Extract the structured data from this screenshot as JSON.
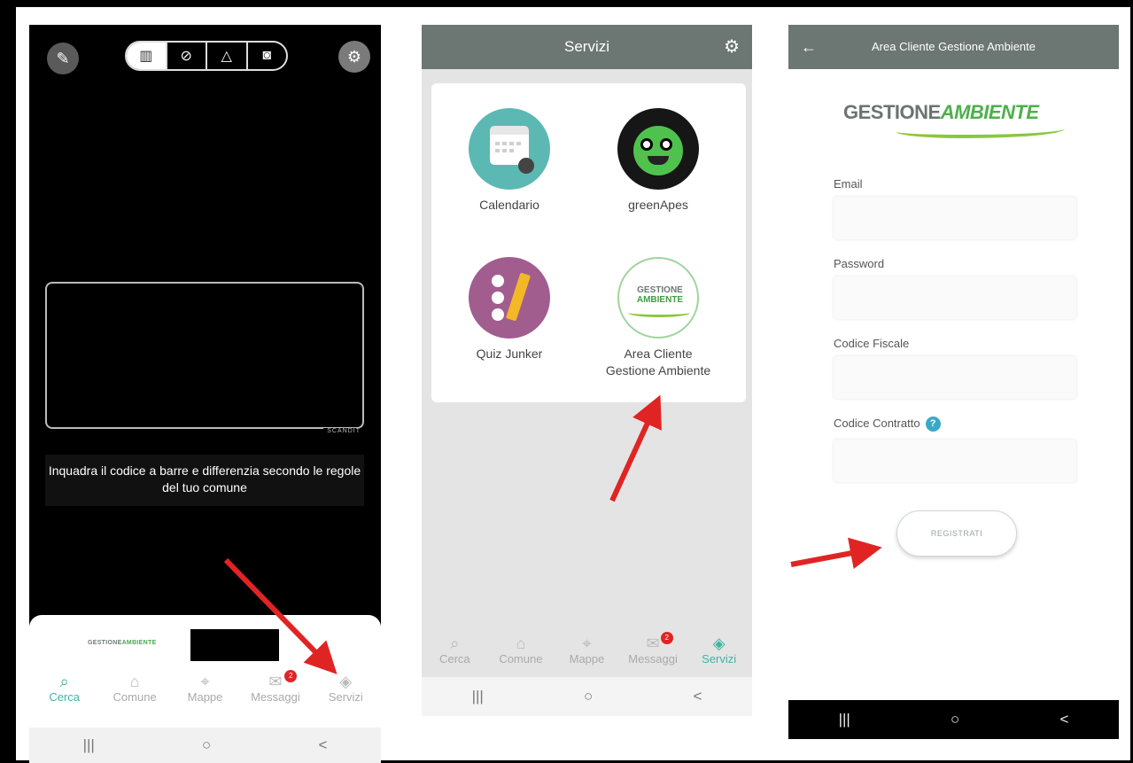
{
  "screen1": {
    "mode_icons": [
      "barcode-icon",
      "search-icon",
      "warning-icon",
      "camera-icon"
    ],
    "scan_brand": "SCANDIT",
    "hint_text": "Inquadra il codice a barre e differenzia secondo le regole del tuo comune",
    "mini_logo": {
      "part1": "GESTIONE",
      "part2": "AMBIENTE"
    },
    "tabs": [
      {
        "label": "Cerca",
        "icon": "search-icon",
        "active": true
      },
      {
        "label": "Comune",
        "icon": "building-icon",
        "active": false
      },
      {
        "label": "Mappe",
        "icon": "map-icon",
        "active": false
      },
      {
        "label": "Messaggi",
        "icon": "mail-icon",
        "active": false,
        "badge": "2"
      },
      {
        "label": "Servizi",
        "icon": "layers-icon",
        "active": false
      }
    ],
    "nav": [
      "|||",
      "○",
      "<"
    ]
  },
  "screen2": {
    "title": "Servizi",
    "services": [
      {
        "label": "Calendario",
        "icon": "calendar-icon"
      },
      {
        "label": "greenApes",
        "icon": "ape-icon"
      },
      {
        "label": "Quiz Junker",
        "icon": "quiz-icon"
      },
      {
        "label_line1": "Area Cliente",
        "label_line2": "Gestione Ambiente",
        "icon": "gestione-ambiente-logo"
      }
    ],
    "logo_small": {
      "part1": "GESTIONE",
      "part2": "AMBIENTE"
    },
    "tabs": [
      {
        "label": "Cerca",
        "icon": "search-icon",
        "active": false
      },
      {
        "label": "Comune",
        "icon": "building-icon",
        "active": false
      },
      {
        "label": "Mappe",
        "icon": "map-icon",
        "active": false
      },
      {
        "label": "Messaggi",
        "icon": "mail-icon",
        "active": false,
        "badge": "2"
      },
      {
        "label": "Servizi",
        "icon": "layers-icon",
        "active": true
      }
    ],
    "nav": [
      "|||",
      "○",
      "<"
    ]
  },
  "screen3": {
    "title": "Area Cliente Gestione Ambiente",
    "logo": {
      "part1": "GESTIONE",
      "part2": "AMBIENTE"
    },
    "fields": [
      {
        "label": "Email",
        "value": ""
      },
      {
        "label": "Password",
        "value": ""
      },
      {
        "label": "Codice Fiscale",
        "value": ""
      },
      {
        "label": "Codice Contratto",
        "value": "",
        "help": "?"
      }
    ],
    "register_label": "REGISTRATI",
    "nav": [
      "|||",
      "○",
      "<"
    ]
  },
  "colors": {
    "header": "#6c7672",
    "accent": "#3fb5a0",
    "arrow": "#e02424",
    "brand_green": "#4db04a"
  }
}
